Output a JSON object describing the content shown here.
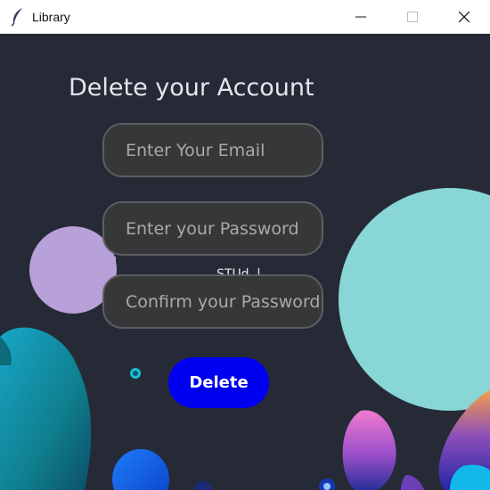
{
  "window": {
    "title": "Library",
    "icon": "feather-icon",
    "controls": [
      "minimize-icon",
      "maximize-icon",
      "close-icon"
    ]
  },
  "form": {
    "heading": "Delete your Account",
    "email_placeholder": "Enter Your Email",
    "password_placeholder": "Enter your Password",
    "confirm_placeholder": "Confirm your Password",
    "obscured_label": "STUd..l..",
    "delete_label": "Delete"
  },
  "colors": {
    "background": "#262a36",
    "field_bg": "#363738",
    "field_border": "#5c5e61",
    "button": "#0000f0",
    "heading": "#e4e6ee"
  }
}
